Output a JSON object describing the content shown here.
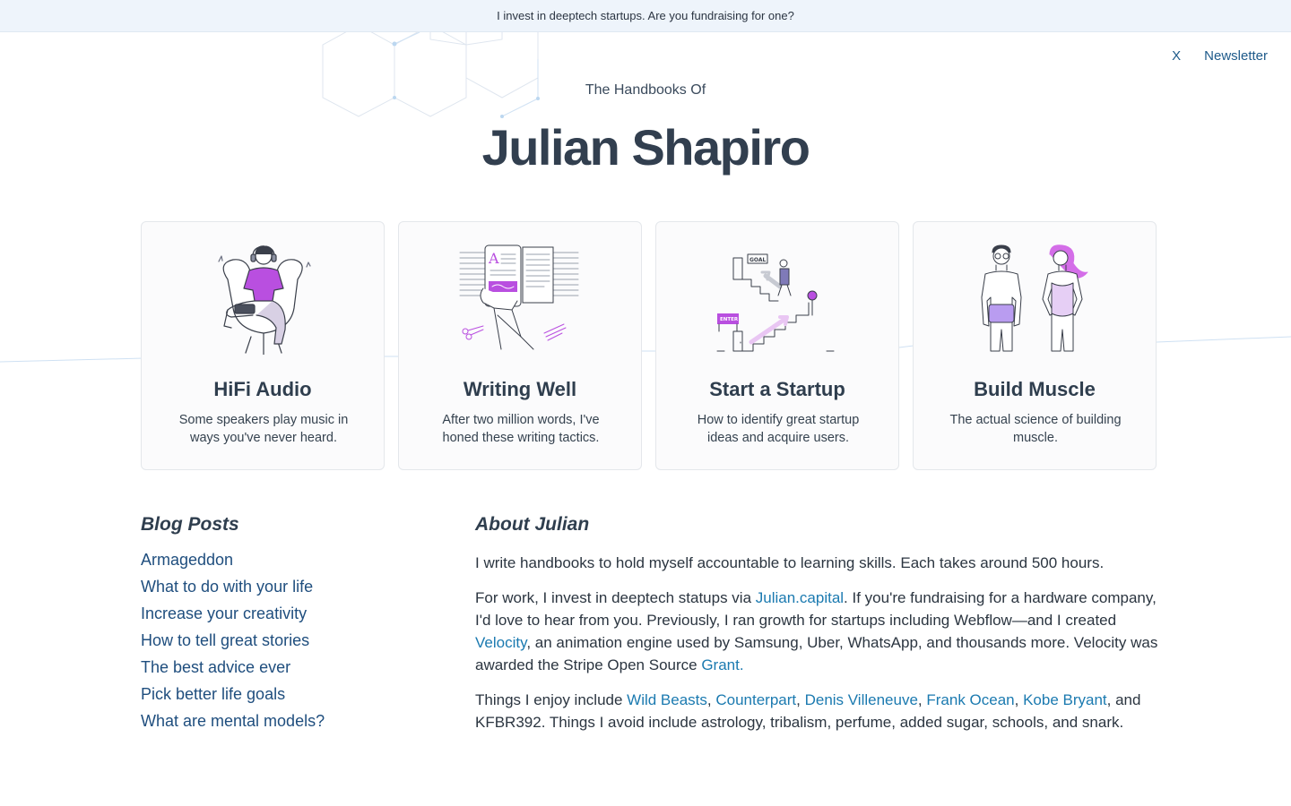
{
  "banner": {
    "text": "I invest in deeptech startups. Are you fundraising for one?"
  },
  "nav": {
    "close_label": "X",
    "newsletter_label": "Newsletter"
  },
  "hero": {
    "eyebrow": "The Handbooks Of",
    "title": "Julian Shapiro"
  },
  "cards": [
    {
      "title": "HiFi Audio",
      "description": "Some speakers play music in ways you've never heard.",
      "icon": "listener-illustration"
    },
    {
      "title": "Writing Well",
      "description": "After two million words, I've honed these writing tactics.",
      "icon": "writing-illustration"
    },
    {
      "title": "Start a Startup",
      "description": "How to identify great startup ideas and acquire users.",
      "icon": "startup-stairs-illustration",
      "goal_label": "GOAL",
      "enter_label": "ENTER"
    },
    {
      "title": "Build Muscle",
      "description": "The actual science of building muscle.",
      "icon": "muscle-people-illustration"
    }
  ],
  "blog": {
    "heading": "Blog Posts",
    "posts": [
      "Armageddon",
      "What to do with your life",
      "Increase your creativity",
      "How to tell great stories",
      "The best advice ever",
      "Pick better life goals",
      "What are mental models?"
    ]
  },
  "about": {
    "heading": "About Julian",
    "p1": "I write handbooks to hold myself accountable to learning skills. Each takes around 500 hours.",
    "p2_a": "For work, I invest in deeptech statups via ",
    "p2_link1": "Julian.capital",
    "p2_b": ". If you're fundraising for a hardware company, I'd love to hear from you. Previously, I ran growth for startups including Webflow—and I created ",
    "p2_link2": "Velocity",
    "p2_c": ", an animation engine used by Samsung, Uber, WhatsApp, and thousands more. Velocity was awarded the Stripe Open Source ",
    "p2_link3": "Grant.",
    "p3_a": "Things I enjoy include ",
    "p3_links": [
      "Wild Beasts",
      "Counterpart",
      "Denis Villeneuve",
      "Frank Ocean",
      "Kobe Bryant"
    ],
    "p3_b": ", and KFBR392. Things I avoid include astrology, tribalism, perfume, added sugar, schools, and snark."
  },
  "colors": {
    "accent_purple": "#b94fe0",
    "link_blue": "#1b7ab0",
    "heading": "#323f4f",
    "banner_bg": "#eef4fb"
  }
}
